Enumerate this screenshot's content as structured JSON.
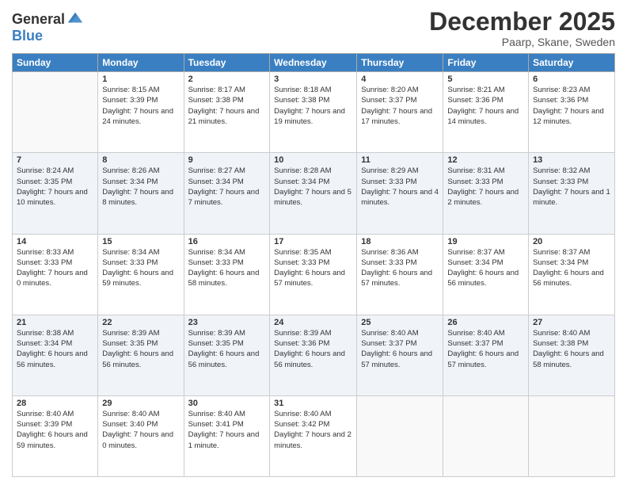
{
  "header": {
    "logo_general": "General",
    "logo_blue": "Blue",
    "month": "December 2025",
    "location": "Paarp, Skane, Sweden"
  },
  "weekdays": [
    "Sunday",
    "Monday",
    "Tuesday",
    "Wednesday",
    "Thursday",
    "Friday",
    "Saturday"
  ],
  "weeks": [
    [
      {
        "day": "",
        "sunrise": "",
        "sunset": "",
        "daylight": ""
      },
      {
        "day": "1",
        "sunrise": "Sunrise: 8:15 AM",
        "sunset": "Sunset: 3:39 PM",
        "daylight": "Daylight: 7 hours and 24 minutes."
      },
      {
        "day": "2",
        "sunrise": "Sunrise: 8:17 AM",
        "sunset": "Sunset: 3:38 PM",
        "daylight": "Daylight: 7 hours and 21 minutes."
      },
      {
        "day": "3",
        "sunrise": "Sunrise: 8:18 AM",
        "sunset": "Sunset: 3:38 PM",
        "daylight": "Daylight: 7 hours and 19 minutes."
      },
      {
        "day": "4",
        "sunrise": "Sunrise: 8:20 AM",
        "sunset": "Sunset: 3:37 PM",
        "daylight": "Daylight: 7 hours and 17 minutes."
      },
      {
        "day": "5",
        "sunrise": "Sunrise: 8:21 AM",
        "sunset": "Sunset: 3:36 PM",
        "daylight": "Daylight: 7 hours and 14 minutes."
      },
      {
        "day": "6",
        "sunrise": "Sunrise: 8:23 AM",
        "sunset": "Sunset: 3:36 PM",
        "daylight": "Daylight: 7 hours and 12 minutes."
      }
    ],
    [
      {
        "day": "7",
        "sunrise": "Sunrise: 8:24 AM",
        "sunset": "Sunset: 3:35 PM",
        "daylight": "Daylight: 7 hours and 10 minutes."
      },
      {
        "day": "8",
        "sunrise": "Sunrise: 8:26 AM",
        "sunset": "Sunset: 3:34 PM",
        "daylight": "Daylight: 7 hours and 8 minutes."
      },
      {
        "day": "9",
        "sunrise": "Sunrise: 8:27 AM",
        "sunset": "Sunset: 3:34 PM",
        "daylight": "Daylight: 7 hours and 7 minutes."
      },
      {
        "day": "10",
        "sunrise": "Sunrise: 8:28 AM",
        "sunset": "Sunset: 3:34 PM",
        "daylight": "Daylight: 7 hours and 5 minutes."
      },
      {
        "day": "11",
        "sunrise": "Sunrise: 8:29 AM",
        "sunset": "Sunset: 3:33 PM",
        "daylight": "Daylight: 7 hours and 4 minutes."
      },
      {
        "day": "12",
        "sunrise": "Sunrise: 8:31 AM",
        "sunset": "Sunset: 3:33 PM",
        "daylight": "Daylight: 7 hours and 2 minutes."
      },
      {
        "day": "13",
        "sunrise": "Sunrise: 8:32 AM",
        "sunset": "Sunset: 3:33 PM",
        "daylight": "Daylight: 7 hours and 1 minute."
      }
    ],
    [
      {
        "day": "14",
        "sunrise": "Sunrise: 8:33 AM",
        "sunset": "Sunset: 3:33 PM",
        "daylight": "Daylight: 7 hours and 0 minutes."
      },
      {
        "day": "15",
        "sunrise": "Sunrise: 8:34 AM",
        "sunset": "Sunset: 3:33 PM",
        "daylight": "Daylight: 6 hours and 59 minutes."
      },
      {
        "day": "16",
        "sunrise": "Sunrise: 8:34 AM",
        "sunset": "Sunset: 3:33 PM",
        "daylight": "Daylight: 6 hours and 58 minutes."
      },
      {
        "day": "17",
        "sunrise": "Sunrise: 8:35 AM",
        "sunset": "Sunset: 3:33 PM",
        "daylight": "Daylight: 6 hours and 57 minutes."
      },
      {
        "day": "18",
        "sunrise": "Sunrise: 8:36 AM",
        "sunset": "Sunset: 3:33 PM",
        "daylight": "Daylight: 6 hours and 57 minutes."
      },
      {
        "day": "19",
        "sunrise": "Sunrise: 8:37 AM",
        "sunset": "Sunset: 3:34 PM",
        "daylight": "Daylight: 6 hours and 56 minutes."
      },
      {
        "day": "20",
        "sunrise": "Sunrise: 8:37 AM",
        "sunset": "Sunset: 3:34 PM",
        "daylight": "Daylight: 6 hours and 56 minutes."
      }
    ],
    [
      {
        "day": "21",
        "sunrise": "Sunrise: 8:38 AM",
        "sunset": "Sunset: 3:34 PM",
        "daylight": "Daylight: 6 hours and 56 minutes."
      },
      {
        "day": "22",
        "sunrise": "Sunrise: 8:39 AM",
        "sunset": "Sunset: 3:35 PM",
        "daylight": "Daylight: 6 hours and 56 minutes."
      },
      {
        "day": "23",
        "sunrise": "Sunrise: 8:39 AM",
        "sunset": "Sunset: 3:35 PM",
        "daylight": "Daylight: 6 hours and 56 minutes."
      },
      {
        "day": "24",
        "sunrise": "Sunrise: 8:39 AM",
        "sunset": "Sunset: 3:36 PM",
        "daylight": "Daylight: 6 hours and 56 minutes."
      },
      {
        "day": "25",
        "sunrise": "Sunrise: 8:40 AM",
        "sunset": "Sunset: 3:37 PM",
        "daylight": "Daylight: 6 hours and 57 minutes."
      },
      {
        "day": "26",
        "sunrise": "Sunrise: 8:40 AM",
        "sunset": "Sunset: 3:37 PM",
        "daylight": "Daylight: 6 hours and 57 minutes."
      },
      {
        "day": "27",
        "sunrise": "Sunrise: 8:40 AM",
        "sunset": "Sunset: 3:38 PM",
        "daylight": "Daylight: 6 hours and 58 minutes."
      }
    ],
    [
      {
        "day": "28",
        "sunrise": "Sunrise: 8:40 AM",
        "sunset": "Sunset: 3:39 PM",
        "daylight": "Daylight: 6 hours and 59 minutes."
      },
      {
        "day": "29",
        "sunrise": "Sunrise: 8:40 AM",
        "sunset": "Sunset: 3:40 PM",
        "daylight": "Daylight: 7 hours and 0 minutes."
      },
      {
        "day": "30",
        "sunrise": "Sunrise: 8:40 AM",
        "sunset": "Sunset: 3:41 PM",
        "daylight": "Daylight: 7 hours and 1 minute."
      },
      {
        "day": "31",
        "sunrise": "Sunrise: 8:40 AM",
        "sunset": "Sunset: 3:42 PM",
        "daylight": "Daylight: 7 hours and 2 minutes."
      },
      {
        "day": "",
        "sunrise": "",
        "sunset": "",
        "daylight": ""
      },
      {
        "day": "",
        "sunrise": "",
        "sunset": "",
        "daylight": ""
      },
      {
        "day": "",
        "sunrise": "",
        "sunset": "",
        "daylight": ""
      }
    ]
  ]
}
